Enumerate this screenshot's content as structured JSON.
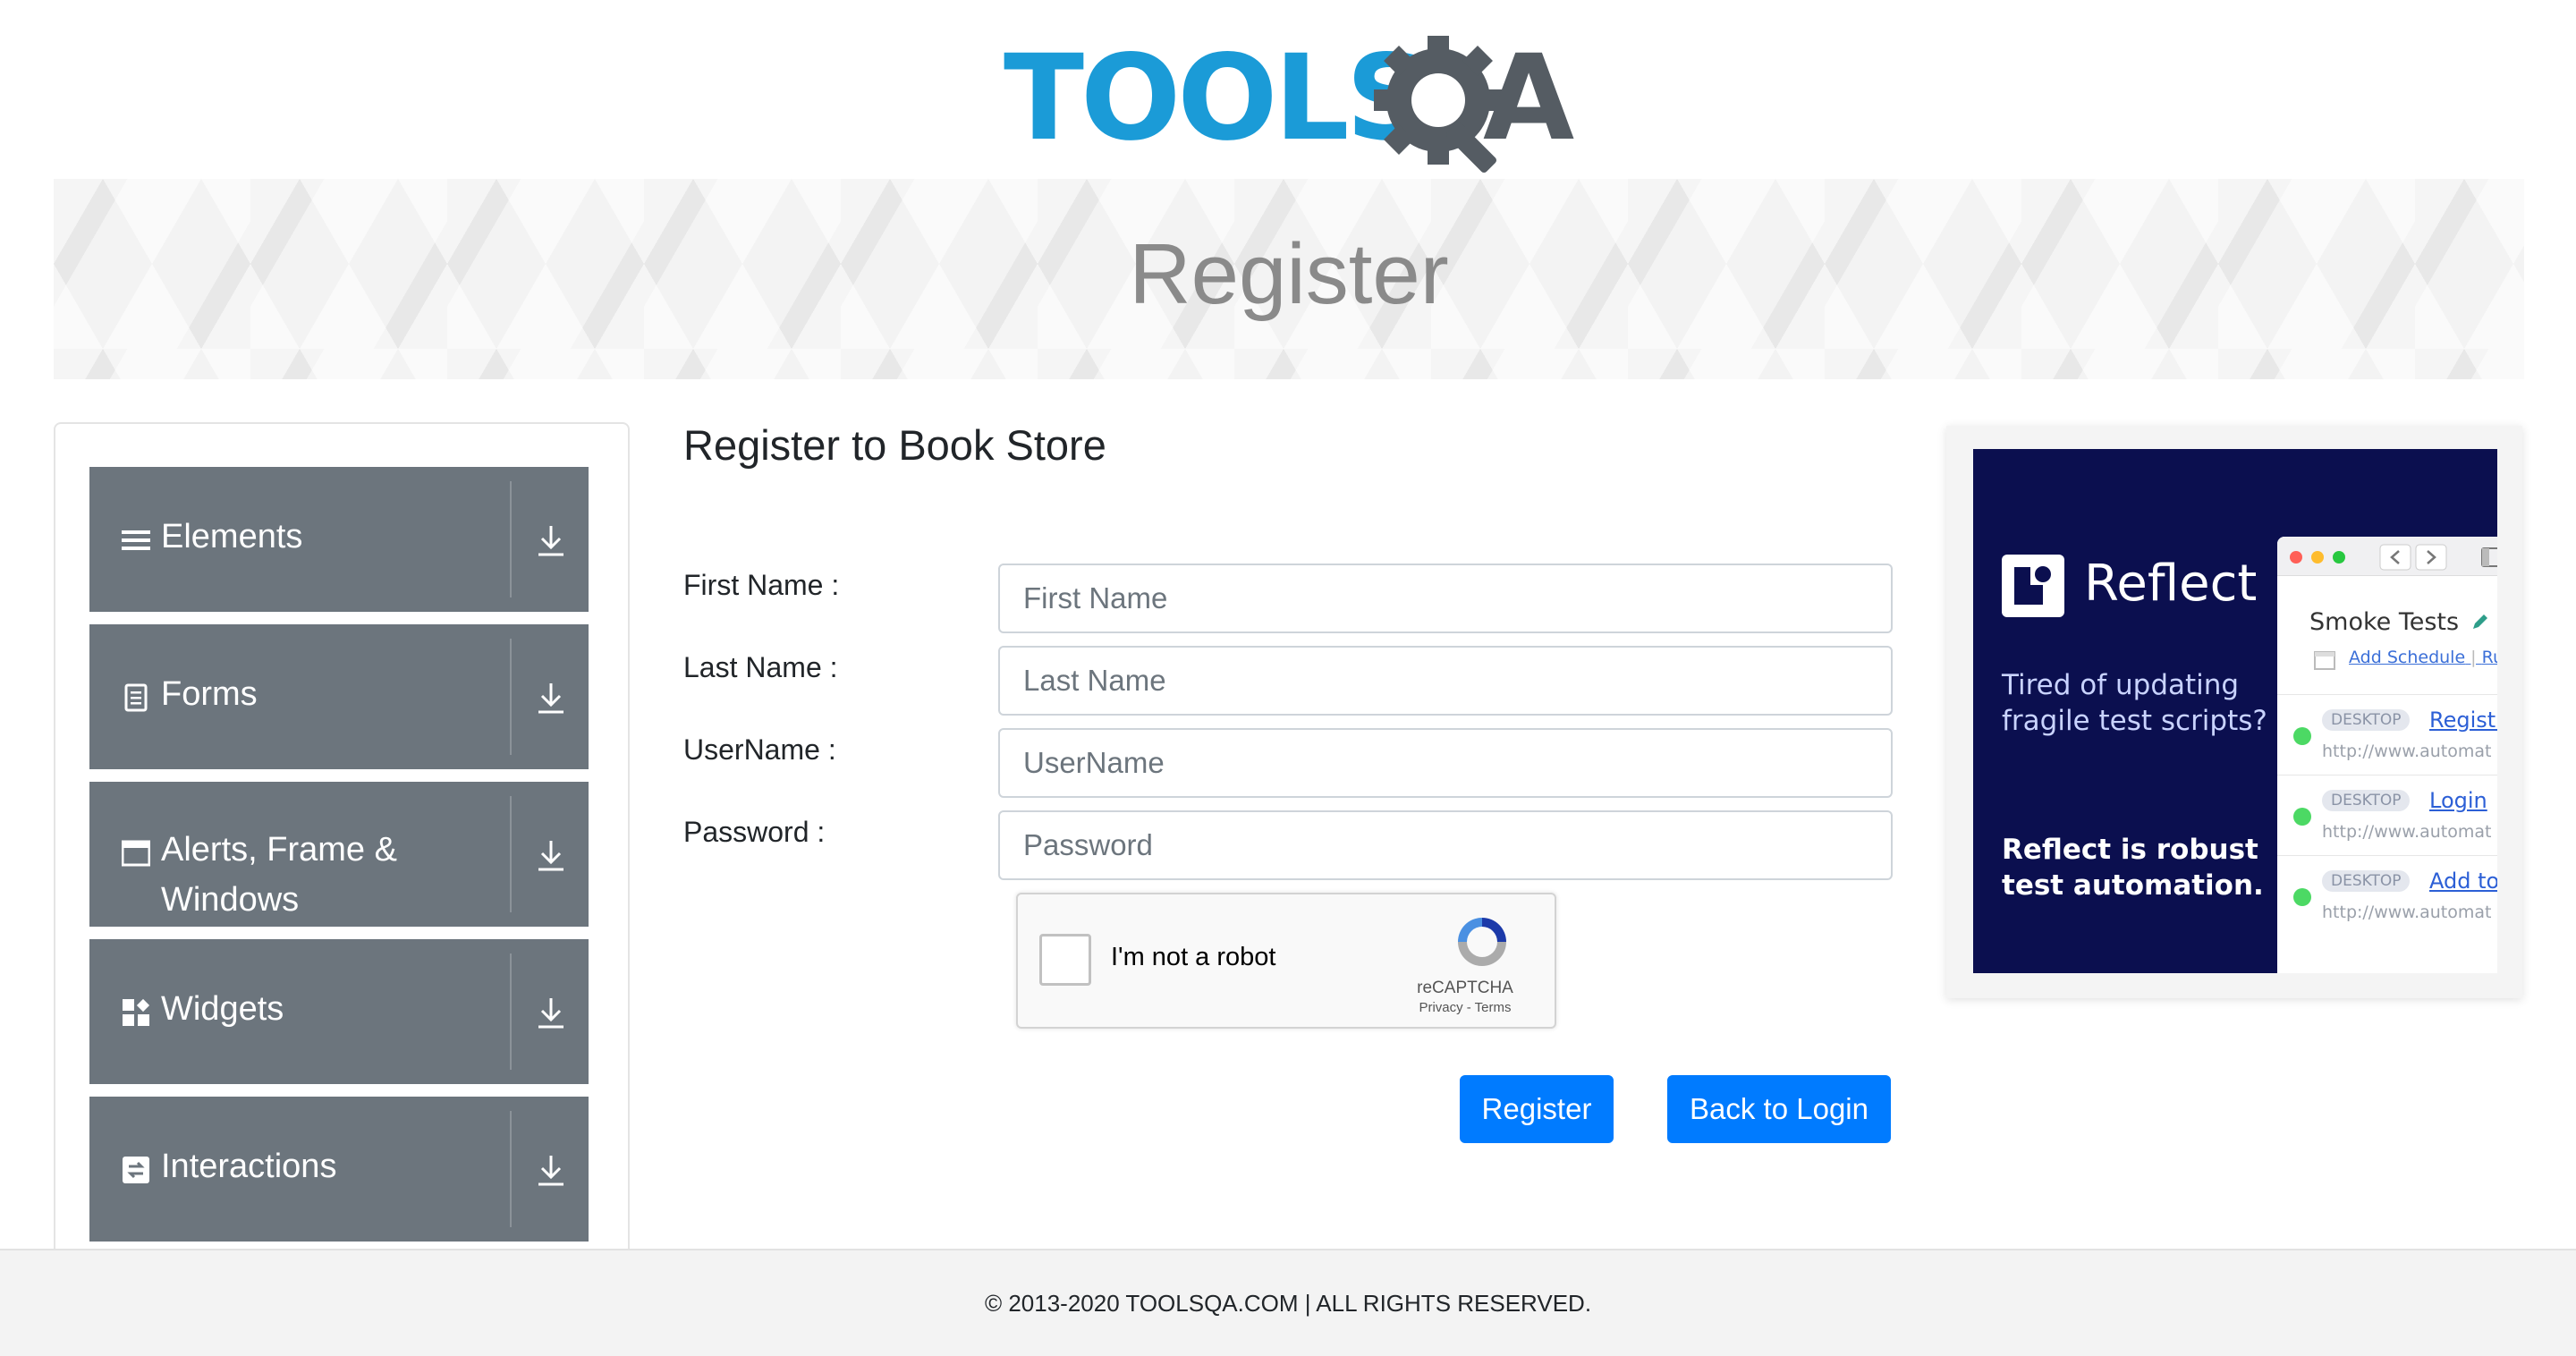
{
  "header": {
    "logo_text_left": "TOOLS",
    "logo_text_right": "A",
    "logo_icon": "gear-magnifier-icon"
  },
  "banner": {
    "title": "Register"
  },
  "sidebar": {
    "groups": [
      {
        "label": "Elements",
        "icon": "hamburger-icon"
      },
      {
        "label": "Forms",
        "icon": "document-icon"
      },
      {
        "label_line1": "Alerts, Frame &",
        "label_line2": "Windows",
        "icon": "window-icon"
      },
      {
        "label": "Widgets",
        "icon": "widgets-icon"
      },
      {
        "label": "Interactions",
        "icon": "interactions-icon"
      }
    ],
    "expand_icon": "download-arrow-icon"
  },
  "form": {
    "heading": "Register to Book Store",
    "fields": [
      {
        "label": "First Name :",
        "placeholder": "First Name",
        "value": ""
      },
      {
        "label": "Last Name :",
        "placeholder": "Last Name",
        "value": ""
      },
      {
        "label": "UserName :",
        "placeholder": "UserName",
        "value": ""
      },
      {
        "label": "Password :",
        "placeholder": "Password",
        "value": ""
      }
    ],
    "recaptcha": {
      "checkbox_label": "I'm not a robot",
      "brand": "reCAPTCHA",
      "links": "Privacy - Terms"
    },
    "buttons": {
      "register": "Register",
      "back_to_login": "Back to Login"
    }
  },
  "ad": {
    "brand": "Reflect",
    "tagline": "Tired of updating fragile test scripts?",
    "subline": "Reflect is robust test automation.",
    "window": {
      "suite_title": "Smoke Tests",
      "add_schedule": "Add Schedule",
      "more_link": "Ru",
      "rows": [
        {
          "badge": "DESKTOP",
          "name": "Registr",
          "url": "http://www.automat"
        },
        {
          "badge": "DESKTOP",
          "name": "Login",
          "url": "http://www.automat"
        },
        {
          "badge": "DESKTOP",
          "name": "Add to",
          "url": "http://www.automat"
        }
      ]
    }
  },
  "footer": {
    "copyright": "© 2013-2020 TOOLSQA.COM | ALL RIGHTS RESERVED."
  },
  "colors": {
    "primary": "#007bff",
    "menu_bg": "#6c757d",
    "logo_blue": "#1b9bd7",
    "logo_gray": "#555c63",
    "ad_bg": "#0b0f4f"
  }
}
